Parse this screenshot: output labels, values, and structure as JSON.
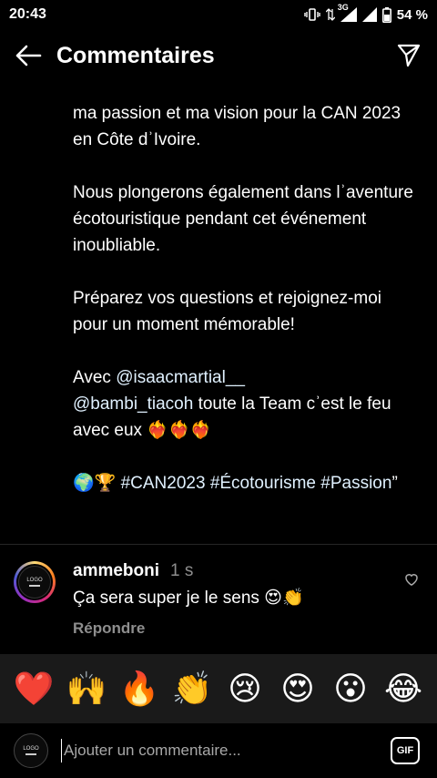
{
  "status_bar": {
    "time": "20:43",
    "network": "3G",
    "battery": "54 %"
  },
  "header": {
    "title": "Commentaires",
    "back_icon": "arrow-left-icon",
    "share_icon": "paper-plane-icon"
  },
  "caption": {
    "para1": "ma passion et ma vision pour la CAN 2023 en Côte dʾIvoire.",
    "para2": "Nous plongerons également dans lʾaventure écotouristique pendant cet événement inoubliable.",
    "para3": "Préparez vos questions et rejoignez-moi pour un moment mémorable!",
    "para4_prefix": "Avec ",
    "mention1": "@isaacmartial__",
    "mention2": "@bambi_tiacoh",
    "para4_suffix": "  toute la Team cʾest le feu avec eux ❤️‍🔥❤️‍🔥❤️‍🔥",
    "para5_emoji": "🌍🏆 ",
    "tags": "#CAN2023 #Écotourisme #Passion",
    "closing_quote": "”"
  },
  "comment": {
    "avatar_text": "LOGO",
    "username": "ammeboni",
    "time": "1 s",
    "text": "Ça sera super je le sens 😍👏",
    "reply": "Répondre",
    "like_icon": "heart-outline-icon"
  },
  "emoji_bar": [
    "❤️",
    "🙌",
    "🔥",
    "👏",
    "😢",
    "😍",
    "😮",
    "😂"
  ],
  "composer": {
    "avatar_text": "LOGO",
    "placeholder": "Ajouter un commentaire...",
    "gif_label": "GIF"
  }
}
